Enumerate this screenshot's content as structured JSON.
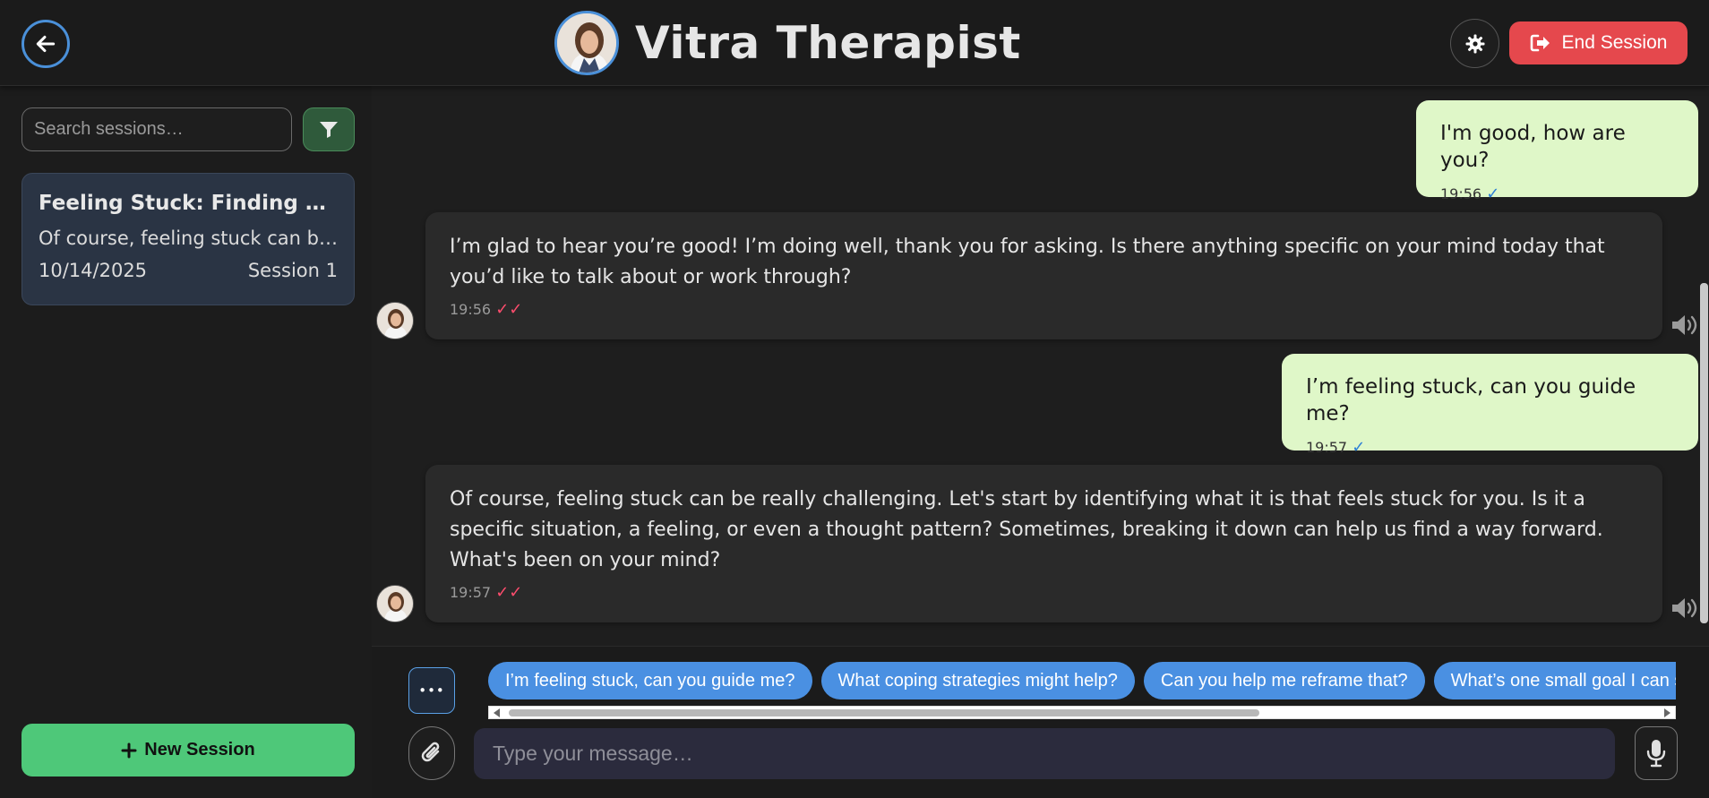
{
  "header": {
    "title": "Vitra Therapist",
    "end_session_label": "End Session",
    "back_icon": "arrow-left-icon",
    "settings_icon": "gear-icon",
    "end_icon": "sign-out-icon"
  },
  "sidebar": {
    "search_placeholder": "Search sessions…",
    "sessions": [
      {
        "title": "Feeling Stuck: Finding Your Way Forward",
        "preview": "Of course, feeling stuck can be really challenging.",
        "date": "10/14/2025",
        "label": "Session 1"
      }
    ],
    "new_session_label": "New Session"
  },
  "messages": [
    {
      "role": "user",
      "text": "I'm good, how are you?",
      "time": "19:56",
      "ticks": "✓"
    },
    {
      "role": "assistant",
      "text": "I’m glad to hear you’re good! I’m doing well, thank you for asking. Is there anything specific on your mind today that you’d like to talk about or work through?",
      "time": "19:56",
      "ticks": "✓✓"
    },
    {
      "role": "user",
      "text": "I’m feeling stuck, can you guide me?",
      "time": "19:57",
      "ticks": "✓"
    },
    {
      "role": "assistant",
      "text": "Of course, feeling stuck can be really challenging. Let's start by identifying what it is that feels stuck for you. Is it a specific situation, a feeling, or even a thought pattern? Sometimes, breaking it down can help us find a way forward. What's been on your mind?",
      "time": "19:57",
      "ticks": "✓✓"
    }
  ],
  "suggestions": [
    "I’m feeling stuck, can you guide me?",
    "What coping strategies might help?",
    "Can you help me reframe that?",
    "What’s one small goal I can set?"
  ],
  "composer": {
    "placeholder": "Type your message…",
    "more_label": "•••"
  },
  "colors": {
    "accent_blue": "#4a90e2",
    "end_red": "#e5484d",
    "new_green": "#4ec879",
    "user_bubble": "#dff7c8",
    "bot_bubble": "#2a2a2a"
  }
}
